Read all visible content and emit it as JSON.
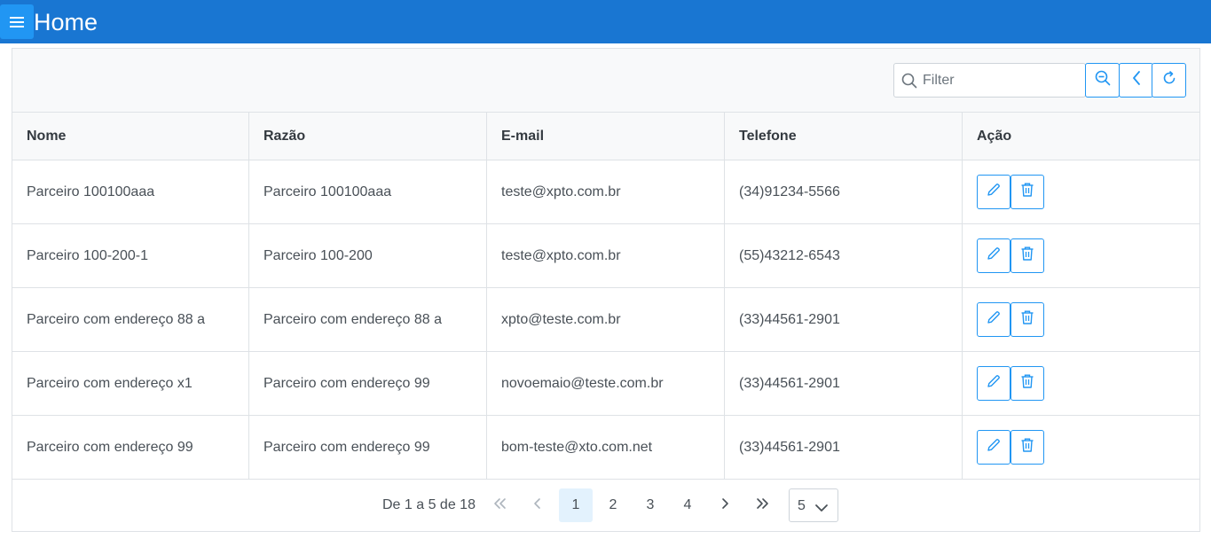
{
  "header": {
    "title": "Home",
    "menu_icon": "hamburger-icon",
    "bg_color": "#1976d2",
    "button_color": "#2196f3"
  },
  "toolbar": {
    "filter_placeholder": "Filter",
    "buttons": [
      "zoom-out-icon",
      "chevron-left-icon",
      "refresh-icon"
    ]
  },
  "table": {
    "columns": [
      "Nome",
      "Razão",
      "E-mail",
      "Telefone",
      "Ação"
    ],
    "rows": [
      {
        "nome": "Parceiro 100100aaa",
        "razao": "Parceiro 100100aaa",
        "email": "teste@xpto.com.br",
        "telefone": "(34)91234-5566"
      },
      {
        "nome": "Parceiro 100-200-1",
        "razao": "Parceiro 100-200",
        "email": "teste@xpto.com.br",
        "telefone": "(55)43212-6543"
      },
      {
        "nome": "Parceiro com endereço 88 a",
        "razao": "Parceiro com endereço 88 a",
        "email": "xpto@teste.com.br",
        "telefone": "(33)44561-2901"
      },
      {
        "nome": "Parceiro com endereço x1",
        "razao": "Parceiro com endereço 99",
        "email": "novoemaio@teste.com.br",
        "telefone": "(33)44561-2901"
      },
      {
        "nome": "Parceiro com endereço 99",
        "razao": "Parceiro com endereço 99",
        "email": "bom-teste@xto.com.net",
        "telefone": "(33)44561-2901"
      }
    ],
    "row_actions": [
      "pencil-icon",
      "trash-icon"
    ]
  },
  "paginator": {
    "summary": "De 1 a 5 de 18",
    "pages": [
      "1",
      "2",
      "3",
      "4"
    ],
    "current_page": "1",
    "rows_per_page": "5"
  },
  "colors": {
    "accent": "#2196f3",
    "active_page_bg": "#e3f2fd"
  }
}
